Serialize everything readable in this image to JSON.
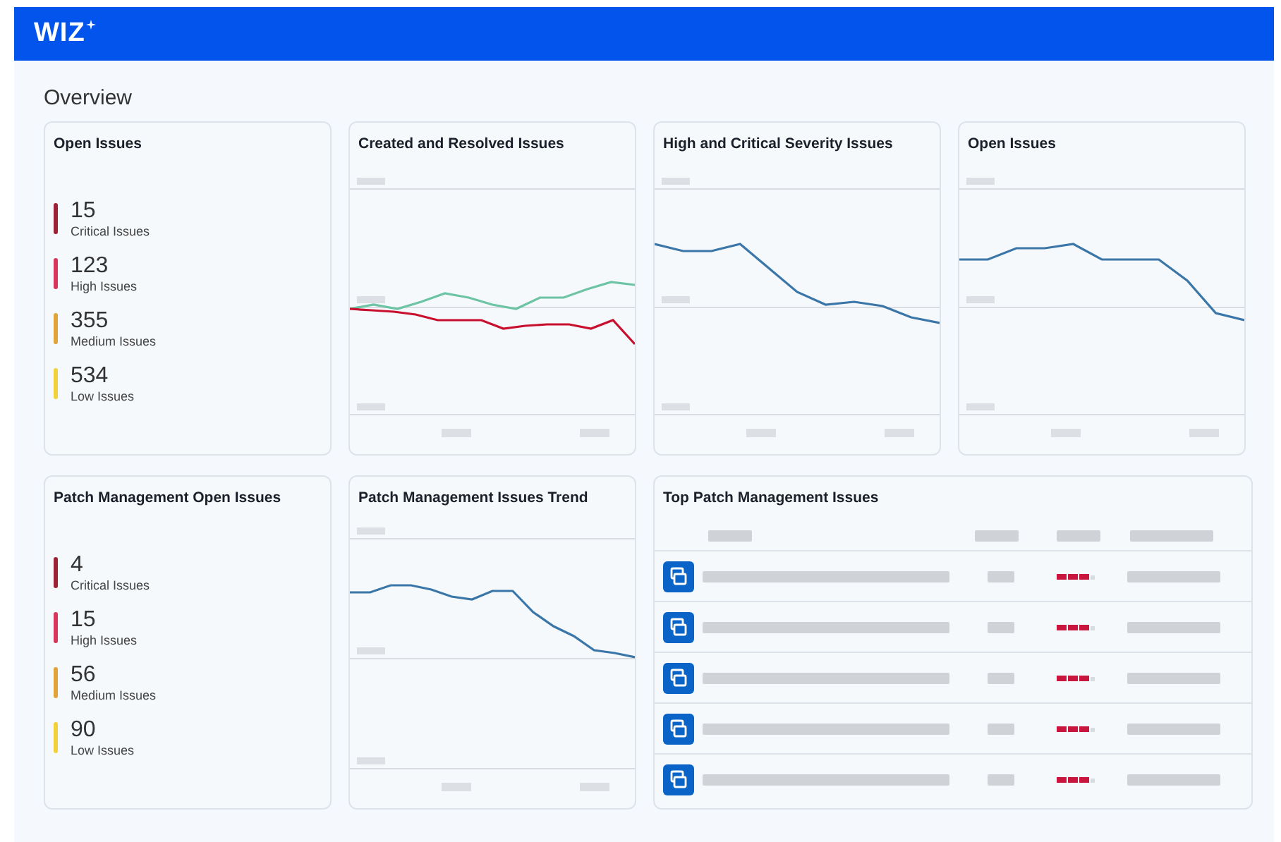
{
  "header": {
    "logo": "WIZ"
  },
  "page": {
    "title": "Overview"
  },
  "cards": [
    {
      "kind": "stats",
      "title": "Open Issues",
      "stats": [
        {
          "value": "15",
          "label": "Critical Issues",
          "color": "#9b2335"
        },
        {
          "value": "123",
          "label": "High Issues",
          "color": "#d6375a"
        },
        {
          "value": "355",
          "label": "Medium Issues",
          "color": "#e0a43a"
        },
        {
          "value": "534",
          "label": "Low Issues",
          "color": "#f2d23a"
        }
      ]
    },
    {
      "kind": "trend",
      "title": "Created and Resolved Issues"
    },
    {
      "kind": "trend",
      "title": "High and Critical Severity Issues"
    },
    {
      "kind": "trend",
      "title": "Open Issues"
    },
    {
      "kind": "stats",
      "title": "Patch Management Open Issues",
      "stats": [
        {
          "value": "4",
          "label": "Critical Issues",
          "color": "#9b2335"
        },
        {
          "value": "15",
          "label": "High Issues",
          "color": "#d6375a"
        },
        {
          "value": "56",
          "label": "Medium Issues",
          "color": "#e0a43a"
        },
        {
          "value": "90",
          "label": "Low Issues",
          "color": "#f2d23a"
        }
      ]
    },
    {
      "kind": "trend",
      "title": "Patch Management Issues Trend"
    },
    {
      "kind": "table",
      "title": "Top Patch Management Issues",
      "rows": [
        {
          "kind": "skeleton"
        },
        {
          "kind": "skeleton"
        },
        {
          "kind": "skeleton"
        },
        {
          "kind": "skeleton"
        },
        {
          "kind": "skeleton"
        }
      ]
    }
  ]
}
